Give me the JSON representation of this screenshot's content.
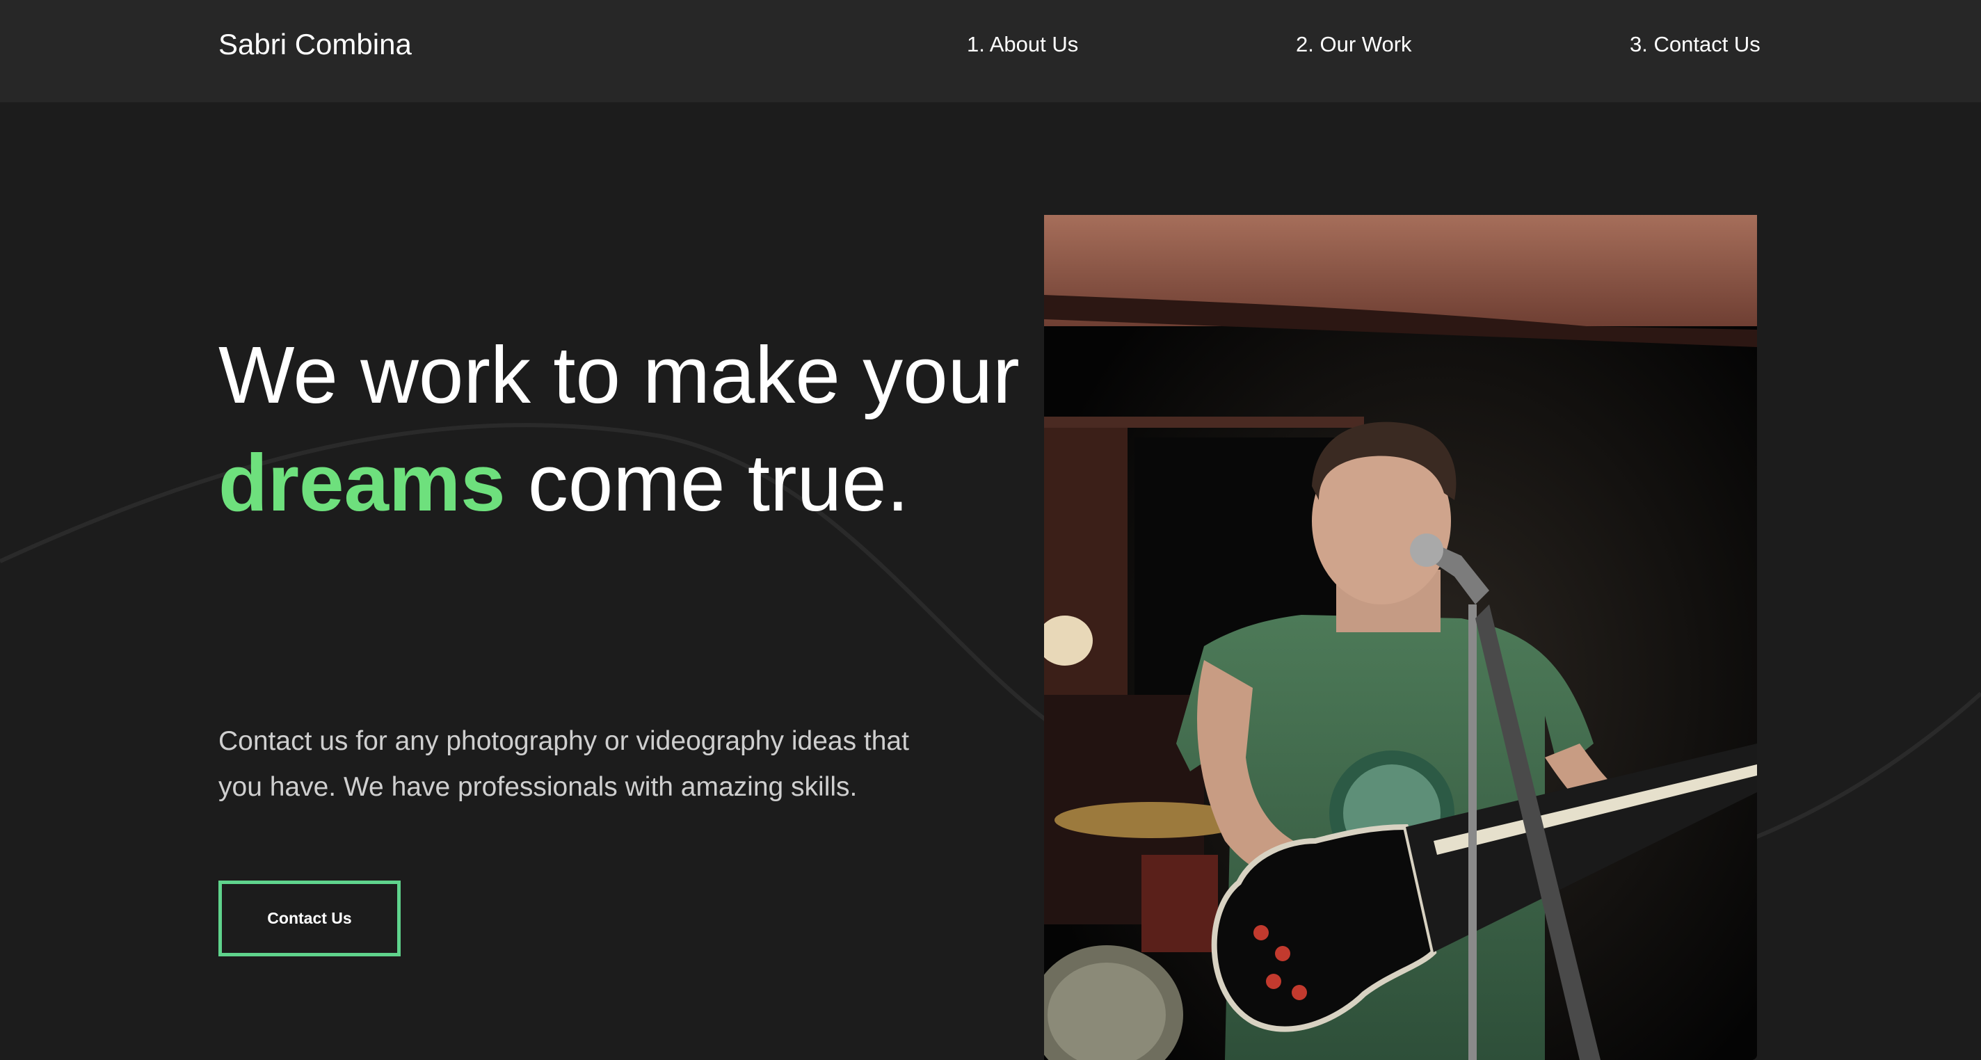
{
  "nav": {
    "brand": "Sabri Combina",
    "links": [
      {
        "label": "1. About Us"
      },
      {
        "label": "2. Our Work"
      },
      {
        "label": "3. Contact Us"
      }
    ]
  },
  "hero": {
    "heading_part1": "We work to make your ",
    "heading_accent": "dreams",
    "heading_part2": " come true.",
    "description": "Contact us for any photography or videography ideas that you have. We have professionals with amazing skills.",
    "cta_label": "Contact Us"
  },
  "colors": {
    "background": "#1c1c1c",
    "navbar": "#272727",
    "accent": "#6ee07d",
    "button_border": "#5fd38c"
  }
}
